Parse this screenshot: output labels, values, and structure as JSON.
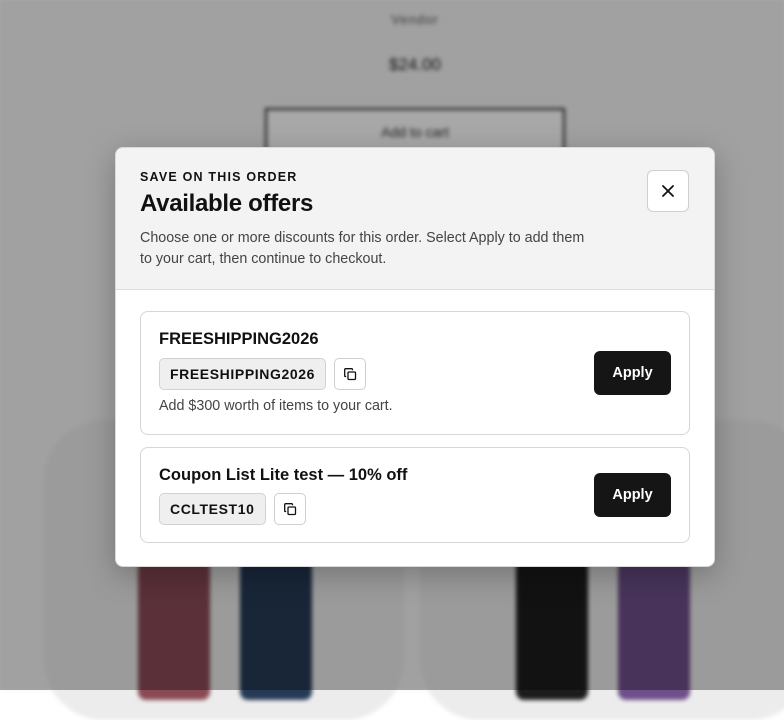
{
  "background": {
    "vendor": "Vendor",
    "price": "$24.00",
    "add_to_cart_label": "Add to cart"
  },
  "modal": {
    "eyebrow": "SAVE ON THIS ORDER",
    "title": "Available offers",
    "description": "Choose one or more discounts for this order. Select Apply to add them to your cart, then continue to checkout.",
    "close_icon": "close-icon"
  },
  "offers": [
    {
      "title": "FREESHIPPING2026",
      "code": "FREESHIPPING2026",
      "note": "Add $300 worth of items to your cart.",
      "apply_label": "Apply",
      "copy_icon": "copy-icon"
    },
    {
      "title": "Coupon List Lite test — 10% off",
      "code": "CCLTEST10",
      "apply_label": "Apply",
      "copy_icon": "copy-icon"
    }
  ],
  "colors": {
    "apply_button": "#151515",
    "header_background": "#f3f3f3",
    "overlay": "rgba(0,0,0,0.34)"
  }
}
